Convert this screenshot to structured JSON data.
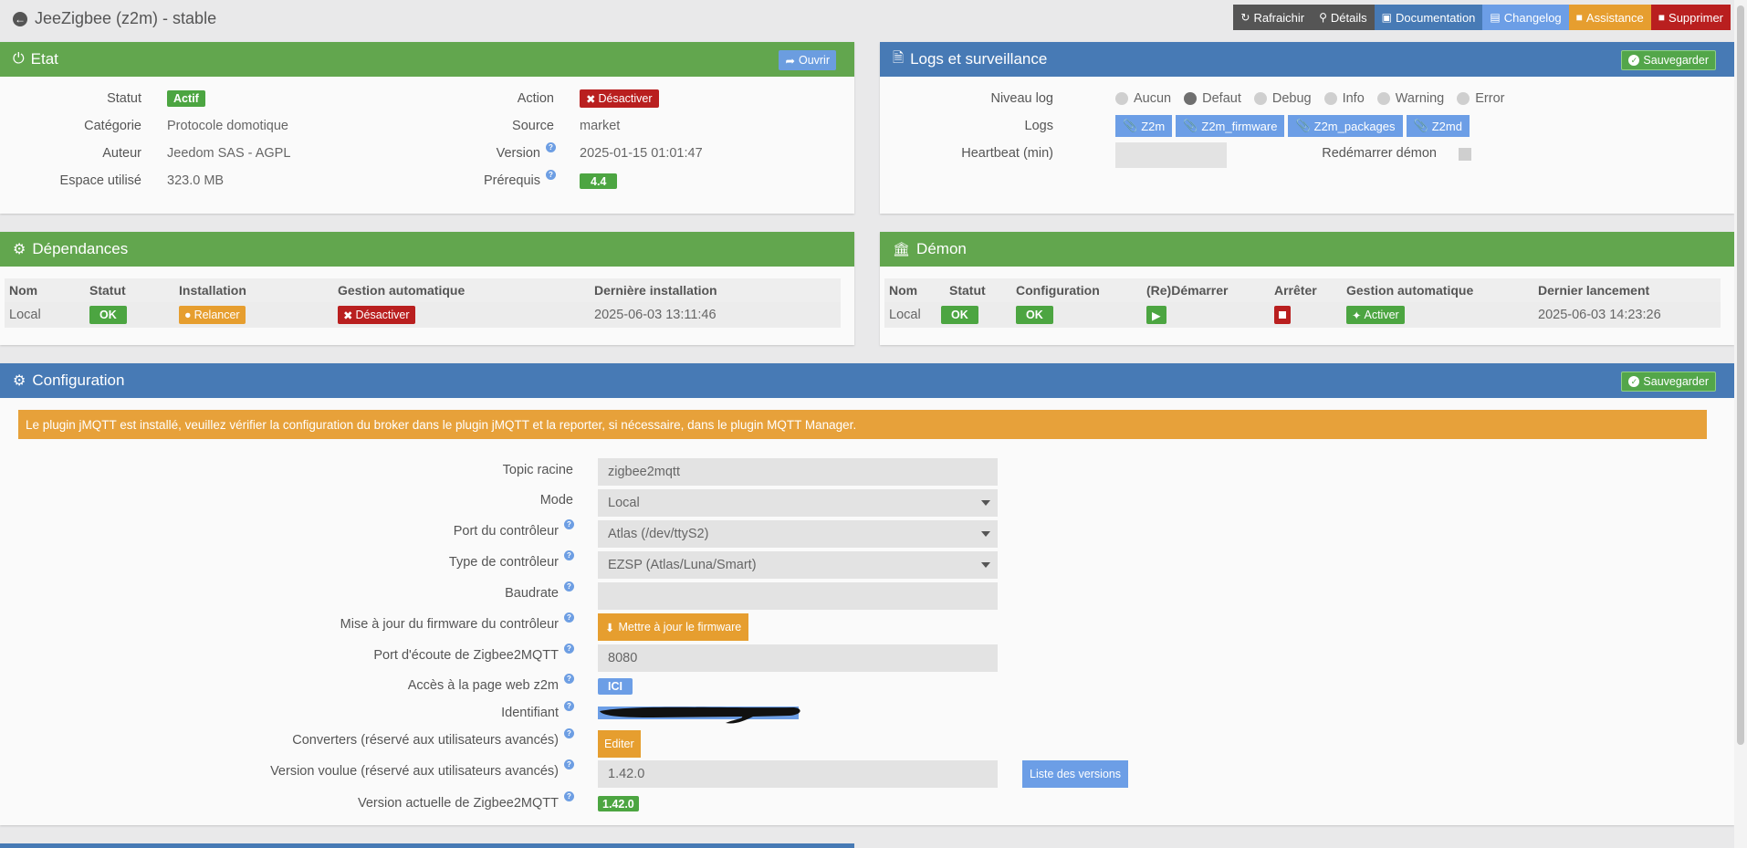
{
  "header": {
    "title": "JeeZigbee (z2m) - stable",
    "actions": [
      {
        "label": "Rafraichir",
        "icon": "refresh-icon",
        "color": "#555555"
      },
      {
        "label": "Détails",
        "icon": "search-icon",
        "color": "#555555"
      },
      {
        "label": "Documentation",
        "icon": "book-icon",
        "color": "#477ab5"
      },
      {
        "label": "Changelog",
        "icon": "file-icon",
        "color": "#6c9ee6"
      },
      {
        "label": "Assistance",
        "icon": "truck-icon",
        "color": "#e69e2f"
      },
      {
        "label": "Supprimer",
        "icon": "trash-icon",
        "color": "#b91f1f"
      }
    ]
  },
  "etat": {
    "title": "Etat",
    "open_label": "Ouvrir",
    "statut_label": "Statut",
    "statut_value": "Actif",
    "categorie_label": "Catégorie",
    "categorie_value": "Protocole domotique",
    "auteur_label": "Auteur",
    "auteur_value": "Jeedom SAS - AGPL",
    "espace_label": "Espace utilisé",
    "espace_value": "323.0 MB",
    "action_label": "Action",
    "action_value": "Désactiver",
    "source_label": "Source",
    "source_value": "market",
    "version_label": "Version",
    "version_value": "2025-01-15 01:01:47",
    "prerequis_label": "Prérequis",
    "prerequis_value": "4.4"
  },
  "logs": {
    "title": "Logs et surveillance",
    "save_label": "Sauvegarder",
    "niveau_label": "Niveau log",
    "levels": [
      "Aucun",
      "Defaut",
      "Debug",
      "Info",
      "Warning",
      "Error"
    ],
    "selected_level": "Defaut",
    "logs_label": "Logs",
    "log_files": [
      "Z2m",
      "Z2m_firmware",
      "Z2m_packages",
      "Z2md"
    ],
    "heartbeat_label": "Heartbeat (min)",
    "heartbeat_value": "",
    "restart_label": "Redémarrer démon"
  },
  "dependances": {
    "title": "Dépendances",
    "headers": [
      "Nom",
      "Statut",
      "Installation",
      "Gestion automatique",
      "Dernière installation"
    ],
    "row": {
      "nom": "Local",
      "statut": "OK",
      "installation": "Relancer",
      "gestion": "Désactiver",
      "derniere": "2025-06-03 13:11:46"
    }
  },
  "demon": {
    "title": "Démon",
    "headers": [
      "Nom",
      "Statut",
      "Configuration",
      "(Re)Démarrer",
      "Arrêter",
      "Gestion automatique",
      "Dernier lancement"
    ],
    "row": {
      "nom": "Local",
      "statut": "OK",
      "configuration": "OK",
      "gestion": "Activer",
      "dernier": "2025-06-03 14:23:26"
    }
  },
  "configuration": {
    "title": "Configuration",
    "save_label": "Sauvegarder",
    "alert": "Le plugin jMQTT est installé, veuillez vérifier la configuration du broker dans le plugin jMQTT et la reporter, si nécessaire, dans le plugin MQTT Manager.",
    "fields": {
      "topic_label": "Topic racine",
      "topic_placeholder": "zigbee2mqtt",
      "mode_label": "Mode",
      "mode_value": "Local",
      "port_label": "Port du contrôleur",
      "port_value": "Atlas (/dev/ttyS2)",
      "type_label": "Type de contrôleur",
      "type_value": "EZSP (Atlas/Luna/Smart)",
      "baudrate_label": "Baudrate",
      "baudrate_value": "",
      "firmware_label": "Mise à jour du firmware du contrôleur",
      "firmware_button": "Mettre à jour le firmware",
      "listen_label": "Port d'écoute de Zigbee2MQTT",
      "listen_placeholder": "8080",
      "web_label": "Accès à la page web z2m",
      "web_button": "ICI",
      "ident_label": "Identifiant",
      "converters_label": "Converters (réservé aux utilisateurs avancés)",
      "converters_button": "Editer",
      "wanted_label": "Version voulue (réservé aux utilisateurs avancés)",
      "wanted_placeholder": "1.42.0",
      "versions_button": "Liste des versions",
      "current_label": "Version actuelle de Zigbee2MQTT",
      "current_value": "1.42.0"
    }
  }
}
